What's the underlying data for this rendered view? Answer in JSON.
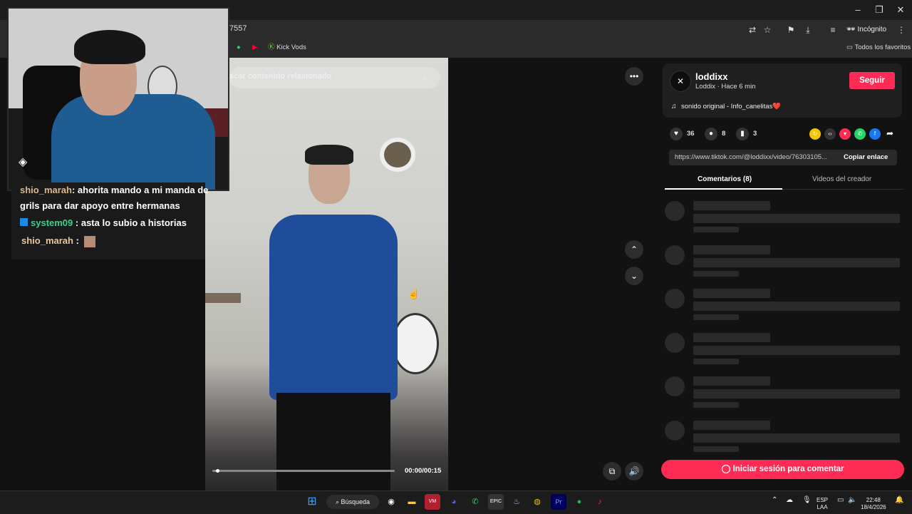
{
  "browser": {
    "url_fragment": "7557",
    "incognito_label": "Incógnito",
    "bookmarks": [
      {
        "label": "Kick Vods"
      }
    ],
    "all_bookmarks_label": "Todos los favoritos",
    "window_controls": [
      "–",
      "❐",
      "✕"
    ]
  },
  "video": {
    "search_placeholder": "scar contenido relacionado",
    "time": "00:00/00:15",
    "progress_fraction": 0.02
  },
  "chat": {
    "lines": [
      {
        "user": "shio_marah",
        "text": ": ahorita mando a mi manda de",
        "user_color": "#d9b98f"
      },
      {
        "user": "",
        "text": "grils para dar apoyo entre hermanas",
        "user_color": "#ffffff"
      },
      {
        "user": "system09",
        "text": " : asta lo subio a historias",
        "user_color": "#3fcf8e"
      },
      {
        "user": "shio_marah",
        "text": " :",
        "user_color": "#e8c79a"
      }
    ]
  },
  "creator": {
    "name": "loddixx",
    "subtitle": "Loddix · Hace 6 min",
    "follow_label": "Seguir",
    "sound": "sonido original - Info_canelitas❤️"
  },
  "stats": {
    "likes": "36",
    "comments": "8",
    "saves": "3"
  },
  "share_colors": [
    "#f5c400",
    "#2a2a2a",
    "#fe2c55",
    "#25d366",
    "#1877f2"
  ],
  "link": {
    "url": "https://www.tiktok.com/@loddixx/video/76303105...",
    "copy_label": "Copiar enlace"
  },
  "tabs": {
    "comments": "Comentarios (8)",
    "creator_videos": "Videos del creador"
  },
  "login_label": "Iniciar sesión para comentar",
  "taskbar": {
    "search_label": "Búsqueda",
    "lang_top": "ESP",
    "lang_bottom": "LAA",
    "time": "22:48",
    "date": "18/4/2026"
  }
}
